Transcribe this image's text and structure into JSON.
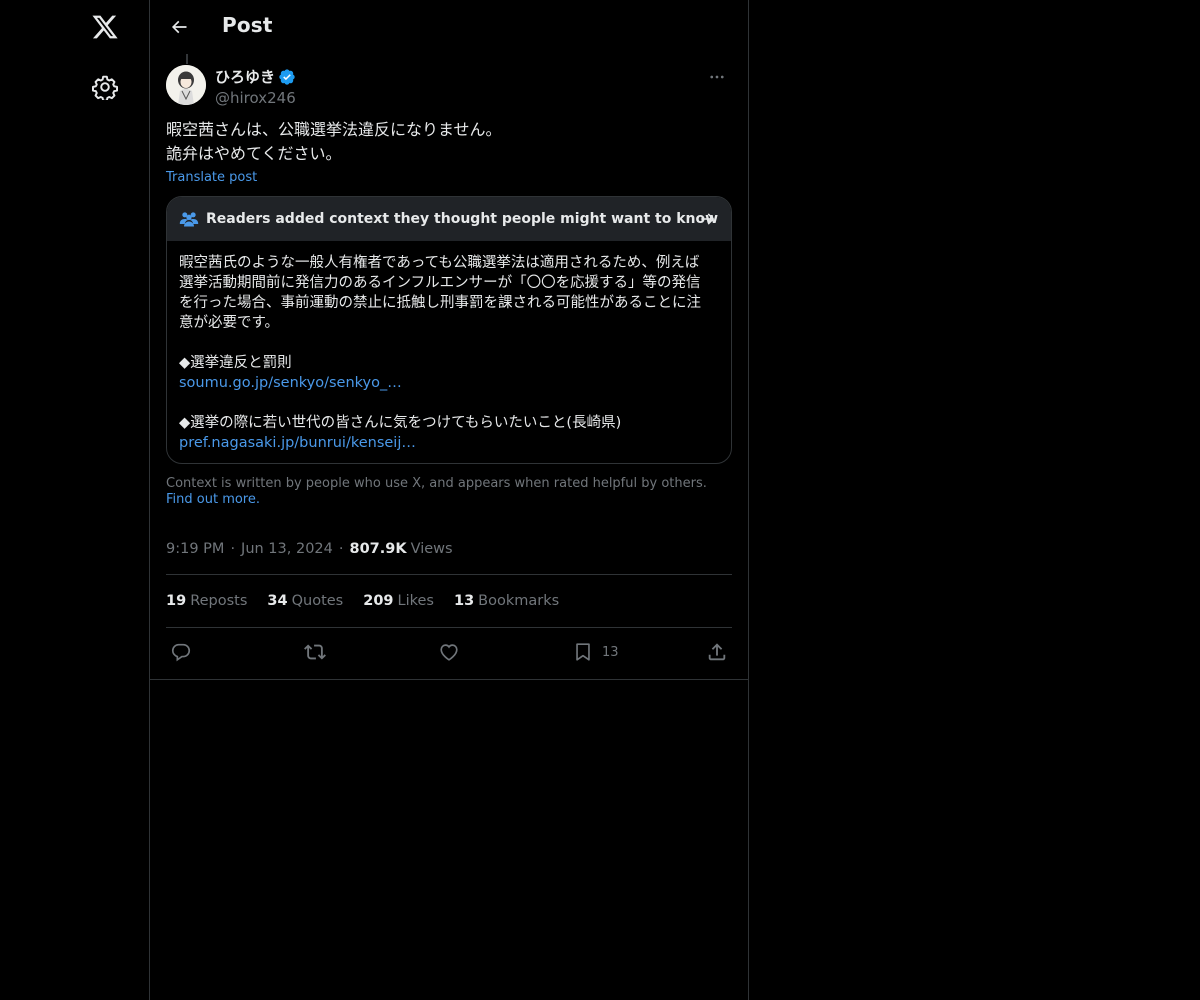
{
  "nav": {
    "logo_icon": "x-logo-icon",
    "settings_icon": "gear-icon"
  },
  "header": {
    "back_icon": "arrow-left-icon",
    "title": "Post"
  },
  "post": {
    "author": {
      "name": "ひろゆき",
      "handle": "@hirox246",
      "verified": true
    },
    "text_lines": [
      "暇空茜さんは、公職選挙法違反になりません。",
      "詭弁はやめてください。"
    ],
    "translate_label": "Translate post",
    "community_note": {
      "header": "Readers added context they thought people might want to know",
      "body_lines": [
        "暇空茜氏のような一般人有権者であっても公職選挙法は適用されるため、例えば",
        "選挙活動期間前に発信力のあるインフルエンサーが「〇〇を応援する」等の発信",
        "を行った場合、事前運動の禁止に抵触し刑事罰を課される可能性があることに注",
        "意が必要です。"
      ],
      "section1_title": "◆選挙違反と罰則",
      "section1_link": "soumu.go.jp/senkyo/senkyo_…",
      "section2_title": "◆選挙の際に若い世代の皆さんに気をつけてもらいたいこと(長崎県)",
      "section2_link": "pref.nagasaki.jp/bunrui/kenseij…"
    },
    "context_footer": {
      "text": "Context is written by people who use X, and appears when rated helpful by others.",
      "link_label": "Find out more."
    },
    "meta": {
      "time": "9:19 PM",
      "date": "Jun 13, 2024",
      "views_count": "807.9K",
      "views_label": "Views"
    },
    "stats": {
      "reposts_count": "19",
      "reposts_label": "Reposts",
      "quotes_count": "34",
      "quotes_label": "Quotes",
      "likes_count": "209",
      "likes_label": "Likes",
      "bookmarks_count": "13",
      "bookmarks_label": "Bookmarks"
    },
    "actions": {
      "bookmark_count": "13"
    }
  },
  "colors": {
    "background": "#000000",
    "text": "#e7e9ea",
    "muted": "#71767b",
    "link": "#4a99e9",
    "border": "#2f3336",
    "note_header_bg": "#202327",
    "verified": "#1d9bf0"
  }
}
